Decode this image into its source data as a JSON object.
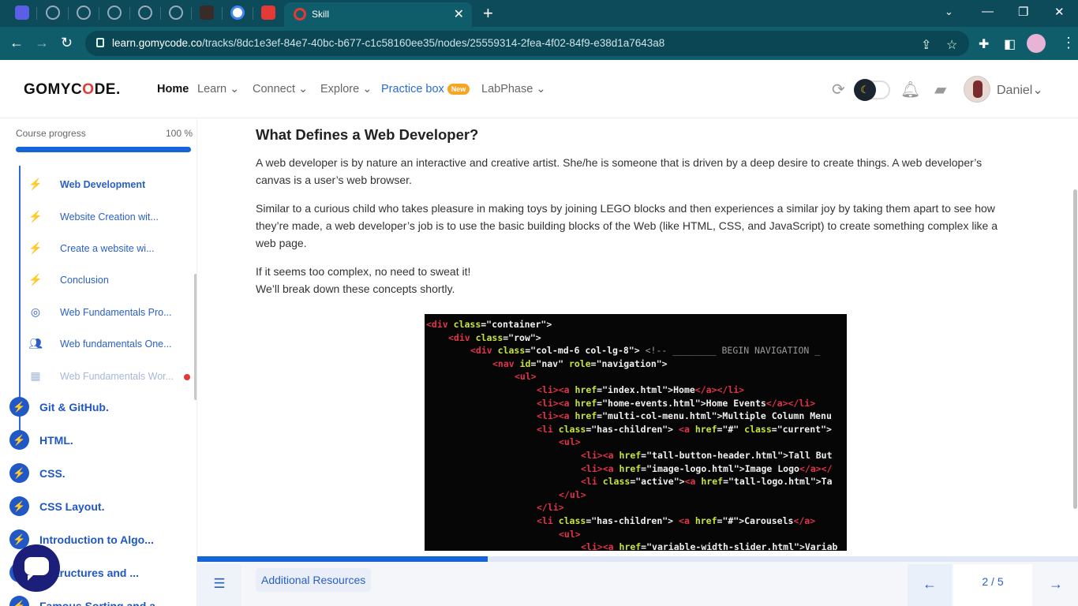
{
  "browser": {
    "active_tab_title": "Skill",
    "new_tab": "+",
    "tab_close": "✕",
    "url_host": "learn.gomycode.co",
    "url_path": "/tracks/8dc1e3ef-84e7-40bc-b677-c1c58160ee35/nodes/25559314-2fea-4f02-84f9-e38d1a7643a8",
    "minimize": "—",
    "restore": "❐",
    "close": "✕"
  },
  "header": {
    "logo_prefix": "GOMYC",
    "logo_o": "O",
    "logo_suffix": "DE.",
    "nav": {
      "home": "Home",
      "learn": "Learn",
      "connect": "Connect",
      "explore": "Explore",
      "practice": "Practice box",
      "practice_badge": "New",
      "labphase": "LabPhase"
    },
    "username": "Daniel"
  },
  "sidebar": {
    "progress_label": "Course progress",
    "progress_text": "100 %",
    "progress_value": 1.0,
    "sub_items": [
      {
        "label": "Web Development",
        "icon": "bolt-icon",
        "state": "active"
      },
      {
        "label": "Website Creation wit...",
        "icon": "bolt-icon",
        "state": "normal"
      },
      {
        "label": "Create a website wi...",
        "icon": "bolt-icon",
        "state": "normal"
      },
      {
        "label": "Conclusion",
        "icon": "bolt-icon",
        "state": "normal"
      },
      {
        "label": "Web Fundamentals Pro...",
        "icon": "target-icon",
        "state": "normal"
      },
      {
        "label": "Web fundamentals One...",
        "icon": "people-icon",
        "state": "normal"
      },
      {
        "label": "Web Fundamentals Wor...",
        "icon": "workshop-icon",
        "state": "locked"
      }
    ],
    "modules": [
      {
        "label": "Git & GitHub."
      },
      {
        "label": "HTML."
      },
      {
        "label": "CSS."
      },
      {
        "label": "CSS Layout."
      },
      {
        "label": "Introduction to Algo..."
      },
      {
        "label": "a Structures and ..."
      },
      {
        "label": "Famous Sorting and a..."
      }
    ]
  },
  "content": {
    "heading": "What Defines a Web Developer?",
    "para1": "A web developer is by nature an interactive and creative artist. She/he is someone that is driven by a deep desire to create things. A web developer’s canvas is a user’s web browser.",
    "para2": "Similar to a curious child who takes pleasure in making toys by joining LEGO blocks and then experiences a similar joy by taking them apart to see how they’re made, a web developer’s job is to use the basic building blocks of the Web (like HTML, CSS, and JavaScript) to create something complex like a web page.",
    "para3_line1": "If it seems too complex, no need to sweat it!",
    "para3_line2": "We’ll break down these concepts shortly."
  },
  "code_image": {
    "lines": [
      {
        "indent": 0,
        "parts": [
          [
            "t",
            "<div "
          ],
          [
            "a",
            "class"
          ],
          [
            "s",
            "=\"container\">"
          ]
        ]
      },
      {
        "indent": 1,
        "parts": [
          [
            "t",
            "<div "
          ],
          [
            "a",
            "class"
          ],
          [
            "s",
            "=\"row\">"
          ]
        ]
      },
      {
        "indent": 2,
        "parts": [
          [
            "t",
            "<div "
          ],
          [
            "a",
            "class"
          ],
          [
            "s",
            "=\"col-md-6 col-lg-8\"> "
          ],
          [
            "c",
            "<!-- ________ BEGIN NAVIGATION _"
          ]
        ]
      },
      {
        "indent": 3,
        "parts": [
          [
            "t",
            "<nav "
          ],
          [
            "a",
            "id"
          ],
          [
            "s",
            "=\"nav\" "
          ],
          [
            "a",
            "role"
          ],
          [
            "s",
            "=\"navigation\">"
          ]
        ]
      },
      {
        "indent": 4,
        "parts": [
          [
            "t",
            "<ul>"
          ]
        ]
      },
      {
        "indent": 5,
        "parts": [
          [
            "t",
            "<li><a "
          ],
          [
            "a",
            "href"
          ],
          [
            "s",
            "=\"index.html\">Home"
          ],
          [
            "t",
            "</a></li>"
          ]
        ]
      },
      {
        "indent": 5,
        "parts": [
          [
            "t",
            "<li><a "
          ],
          [
            "a",
            "href"
          ],
          [
            "s",
            "=\"home-events.html\">Home Events"
          ],
          [
            "t",
            "</a></li>"
          ]
        ]
      },
      {
        "indent": 5,
        "parts": [
          [
            "t",
            "<li><a "
          ],
          [
            "a",
            "href"
          ],
          [
            "s",
            "=\"multi-col-menu.html\">Multiple Column Menu"
          ]
        ]
      },
      {
        "indent": 5,
        "parts": [
          [
            "t",
            "<li "
          ],
          [
            "a",
            "class"
          ],
          [
            "s",
            "=\"has-children\"> "
          ],
          [
            "t",
            "<a "
          ],
          [
            "a",
            "href"
          ],
          [
            "s",
            "=\"#\" "
          ],
          [
            "a",
            "class"
          ],
          [
            "s",
            "=\"current\">"
          ]
        ]
      },
      {
        "indent": 6,
        "parts": [
          [
            "t",
            "<ul>"
          ]
        ]
      },
      {
        "indent": 7,
        "parts": [
          [
            "t",
            "<li><a "
          ],
          [
            "a",
            "href"
          ],
          [
            "s",
            "=\"tall-button-header.html\">Tall But"
          ]
        ]
      },
      {
        "indent": 7,
        "parts": [
          [
            "t",
            "<li><a "
          ],
          [
            "a",
            "href"
          ],
          [
            "s",
            "=\"image-logo.html\">Image Logo"
          ],
          [
            "t",
            "</a></"
          ]
        ]
      },
      {
        "indent": 7,
        "parts": [
          [
            "t",
            "<li "
          ],
          [
            "a",
            "class"
          ],
          [
            "s",
            "=\"active\">"
          ],
          [
            "t",
            "<a "
          ],
          [
            "a",
            "href"
          ],
          [
            "s",
            "=\"tall-logo.html\">Ta"
          ]
        ]
      },
      {
        "indent": 6,
        "parts": [
          [
            "t",
            "</ul>"
          ]
        ]
      },
      {
        "indent": 5,
        "parts": [
          [
            "t",
            "</li>"
          ]
        ]
      },
      {
        "indent": 5,
        "parts": [
          [
            "t",
            "<li "
          ],
          [
            "a",
            "class"
          ],
          [
            "s",
            "=\"has-children\"> "
          ],
          [
            "t",
            "<a "
          ],
          [
            "a",
            "href"
          ],
          [
            "s",
            "=\"#\">Carousels"
          ],
          [
            "t",
            "</a>"
          ]
        ]
      },
      {
        "indent": 6,
        "parts": [
          [
            "t",
            "<ul>"
          ]
        ]
      },
      {
        "indent": 7,
        "parts": [
          [
            "t",
            "<li><a "
          ],
          [
            "a",
            "href"
          ],
          [
            "s",
            "=\"variable-width-slider.html\">Variab"
          ]
        ]
      }
    ]
  },
  "bottom": {
    "resources": "Additional Resources",
    "page_indicator": "2 / 5",
    "lesson_progress": 0.33
  },
  "colors": {
    "brand_blue": "#1565d8",
    "logo_red": "#e53935",
    "browser_teal": "#0f5c6b"
  }
}
